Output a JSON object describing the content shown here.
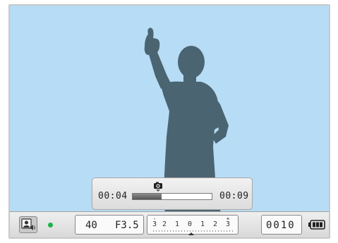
{
  "playback": {
    "elapsed": "00:04",
    "total": "00:09",
    "progress_fraction": 0.37
  },
  "status": {
    "shutter": "40",
    "aperture": "F3.5",
    "exposure_scale": [
      "-",
      "3",
      "2",
      "1",
      "0",
      "1",
      "2",
      "3",
      "+"
    ],
    "shot_count": "0010"
  },
  "colors": {
    "sky": "#b7dcf5",
    "silhouette": "#4b6471",
    "indicator_green": "#1cb34b"
  },
  "icons": {
    "capture": "camera-icon",
    "mode": "person-sound-icon",
    "battery": "battery-full-icon"
  }
}
